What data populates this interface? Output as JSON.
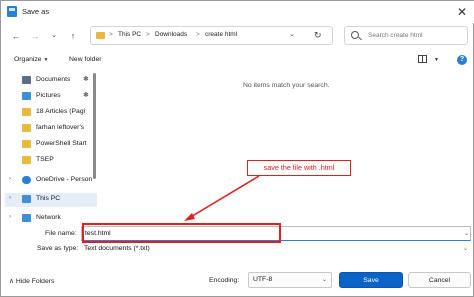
{
  "window": {
    "title": "Save as",
    "close_glyph": "✕"
  },
  "address": {
    "crumbs": [
      "This PC",
      "Downloads",
      "create html"
    ],
    "separator": ">"
  },
  "search": {
    "placeholder": "Search create html"
  },
  "toolbar": {
    "organize": "Organize",
    "new_folder": "New folder"
  },
  "nav": {
    "items": [
      {
        "label": "Documents",
        "pinned": true,
        "icon": "documents-icon",
        "color": "#5b6e86"
      },
      {
        "label": "Pictures",
        "pinned": true,
        "icon": "pictures-icon",
        "color": "#3d8fd8"
      },
      {
        "label": "18 Articles (Pagi",
        "pinned": false,
        "icon": "folder-icon",
        "color": "#e9b93d"
      },
      {
        "label": "farhan leftover's",
        "pinned": false,
        "icon": "folder-icon",
        "color": "#e9b93d"
      },
      {
        "label": "PowerShell Start",
        "pinned": false,
        "icon": "folder-icon",
        "color": "#e9b93d"
      },
      {
        "label": "TSEP",
        "pinned": false,
        "icon": "folder-icon",
        "color": "#e9b93d"
      },
      {
        "label": "OneDrive - Person",
        "pinned": false,
        "icon": "onedrive-icon",
        "color": "#2a7fd4"
      },
      {
        "label": "This PC",
        "pinned": false,
        "icon": "computer-icon",
        "color": "#3d8fd8"
      },
      {
        "label": "Network",
        "pinned": false,
        "icon": "network-icon",
        "color": "#3d8fd8"
      }
    ]
  },
  "content": {
    "empty_message": "No items match your search."
  },
  "annotation": {
    "text": "save the file with .html",
    "color": "#e02020"
  },
  "form": {
    "file_name_label": "File name:",
    "file_name_value": "test.html",
    "save_as_type_label": "Save as type:",
    "save_as_type_value": "Text documents (*.txt)"
  },
  "footer": {
    "hide_folders": "Hide Folders",
    "encoding_label": "Encoding:",
    "encoding_value": "UTF-8",
    "save": "Save",
    "cancel": "Cancel"
  },
  "colors": {
    "accent": "#0a63c7",
    "folder": "#e9b93d",
    "highlight": "#e02020"
  }
}
